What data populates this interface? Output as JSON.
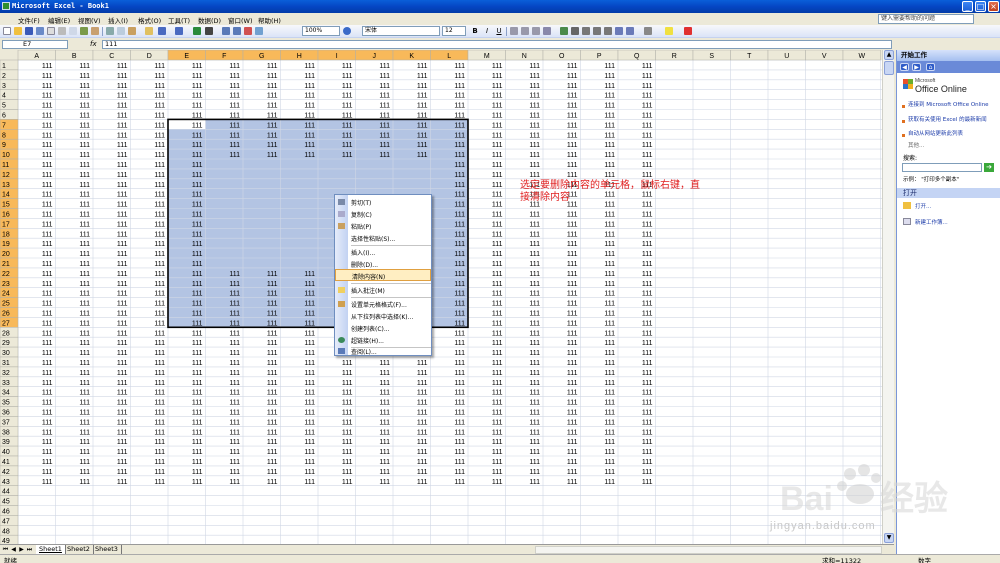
{
  "window": {
    "title": "Microsoft Excel - Book1"
  },
  "menu": {
    "items": [
      "文件(F)",
      "编辑(E)",
      "视图(V)",
      "插入(I)",
      "格式(O)",
      "工具(T)",
      "数据(D)",
      "窗口(W)",
      "帮助(H)"
    ],
    "help_placeholder": "键入需要帮助的问题"
  },
  "toolbar": {
    "zoom": "100%",
    "font": "宋体",
    "font_size": "12",
    "bold": "B",
    "italic": "I",
    "underline": "U"
  },
  "formula_bar": {
    "name_box": "E7",
    "fx": "fx",
    "formula": "111"
  },
  "grid": {
    "columns": [
      "A",
      "B",
      "C",
      "D",
      "E",
      "F",
      "G",
      "H",
      "I",
      "J",
      "K",
      "L",
      "M",
      "N",
      "O",
      "P",
      "Q",
      "R",
      "S",
      "T",
      "U",
      "V",
      "W"
    ],
    "row_count": 49,
    "cell_value": "111",
    "filled_columns_start": 0,
    "filled_columns_end": 16,
    "filled_rows_end": 43,
    "cleared_range": {
      "col_start": 5,
      "col_end": 10,
      "row_start": 11,
      "row_end": 21
    },
    "cleared_top_rows": {
      "col_start": 4,
      "col_end": 10,
      "row_start": 7,
      "row_end": 10
    },
    "selection": {
      "col_start": 4,
      "col_end": 11,
      "row_start": 7,
      "row_end": 27
    },
    "selection_color": "#b3c4e3"
  },
  "context_menu": {
    "items": [
      {
        "label": "剪切(T)",
        "icon": "scissors-icon"
      },
      {
        "label": "复制(C)",
        "icon": "copy-icon"
      },
      {
        "label": "粘贴(P)",
        "icon": "paste-icon"
      },
      {
        "label": "选择性粘贴(S)...",
        "icon": ""
      },
      {
        "label": "插入(I)...",
        "icon": ""
      },
      {
        "label": "删除(D)...",
        "icon": ""
      },
      {
        "label": "清除内容(N)",
        "icon": "",
        "highlight": true
      },
      {
        "label": "插入批注(M)",
        "icon": "comment-icon"
      },
      {
        "label": "设置单元格格式(F)...",
        "icon": "format-cells-icon"
      },
      {
        "label": "从下拉列表中选择(K)...",
        "icon": ""
      },
      {
        "label": "创建列表(C)...",
        "icon": ""
      },
      {
        "label": "超链接(H)...",
        "icon": "hyperlink-icon"
      },
      {
        "label": "查阅(L)...",
        "icon": "lookup-icon"
      }
    ]
  },
  "annotation": {
    "text": "选定要删除内容的单元格，鼠标右键，直接清除内容"
  },
  "sheet_tabs": [
    "Sheet1",
    "Sheet2",
    "Sheet3"
  ],
  "status_bar": {
    "ready": "就绪",
    "sum": "求和=11322",
    "mode": "数字"
  },
  "task_pane": {
    "title": "开始工作",
    "office_small": "Microsoft",
    "office_brand": "Office Online",
    "links": [
      "连接到 Microsoft Office Online",
      "获取有关使用 Excel 的最新新闻",
      "自动从网站更新此列表"
    ],
    "more": "其他...",
    "search_label": "搜索:",
    "example": "示例：  \"打印多个副本\"",
    "open_section": "打开",
    "open_action": "打开...",
    "new_action": "新建工作簿..."
  },
  "watermark": {
    "text": "jingyan.baidu.com"
  },
  "colors": {
    "title_blue": "#0546c4",
    "selection": "#b3c4e3",
    "annotation_red": "#e02020",
    "highlight": "#ffeec2"
  }
}
